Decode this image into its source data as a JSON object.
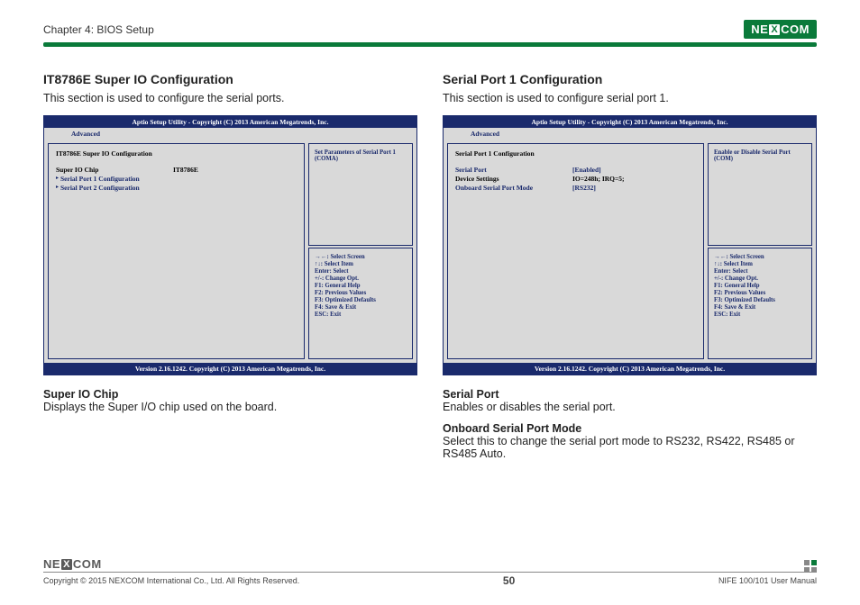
{
  "header": {
    "chapter": "Chapter 4: BIOS Setup",
    "logo_text_a": "NE",
    "logo_text_x": "X",
    "logo_text_b": "COM"
  },
  "left": {
    "title": "IT8786E Super IO Configuration",
    "desc": "This section is used to configure the serial ports.",
    "bios": {
      "top": "Aptio Setup Utility - Copyright (C) 2013 American Megatrends, Inc.",
      "tab": "Advanced",
      "heading": "IT8786E Super IO Configuration",
      "chip_label": "Super IO Chip",
      "chip_value": "IT8786E",
      "link1": "Serial Port 1 Configuration",
      "link2": "Serial Port 2 Configuration",
      "help": "Set Parameters of Serial Port 1 (COMA)",
      "bottom": "Version 2.16.1242. Copyright (C) 2013 American Megatrends, Inc."
    },
    "note1_t": "Super IO Chip",
    "note1_d": "Displays the Super I/O chip used on the board."
  },
  "right": {
    "title": "Serial Port 1 Configuration",
    "desc": "This section is used to configure serial port 1.",
    "bios": {
      "top": "Aptio Setup Utility - Copyright (C) 2013 American Megatrends, Inc.",
      "tab": "Advanced",
      "heading": "Serial Port 1 Configuration",
      "r1l": "Serial Port",
      "r1v": "[Enabled]",
      "r2l": "Device Settings",
      "r2v": "IO=248h; IRQ=5;",
      "r3l": "Onboard Serial Port Mode",
      "r3v": "[RS232]",
      "help": "Enable or Disable Serial Port (COM)",
      "bottom": "Version 2.16.1242. Copyright (C) 2013 American Megatrends, Inc."
    },
    "note1_t": "Serial Port",
    "note1_d": "Enables or disables the serial port.",
    "note2_t": "Onboard Serial Port Mode",
    "note2_d": "Select this to change the serial port mode to RS232, RS422, RS485 or RS485 Auto."
  },
  "keys": {
    "k1": "→←: Select Screen",
    "k2": "↑↓: Select Item",
    "k3": "Enter: Select",
    "k4": "+/-: Change Opt.",
    "k5": "F1: General Help",
    "k6": "F2: Previous Values",
    "k7": "F3: Optimized Defaults",
    "k8": "F4: Save & Exit",
    "k9": "ESC: Exit"
  },
  "footer": {
    "copyright": "Copyright © 2015 NEXCOM International Co., Ltd. All Rights Reserved.",
    "page": "50",
    "manual": "NIFE 100/101 User Manual"
  }
}
